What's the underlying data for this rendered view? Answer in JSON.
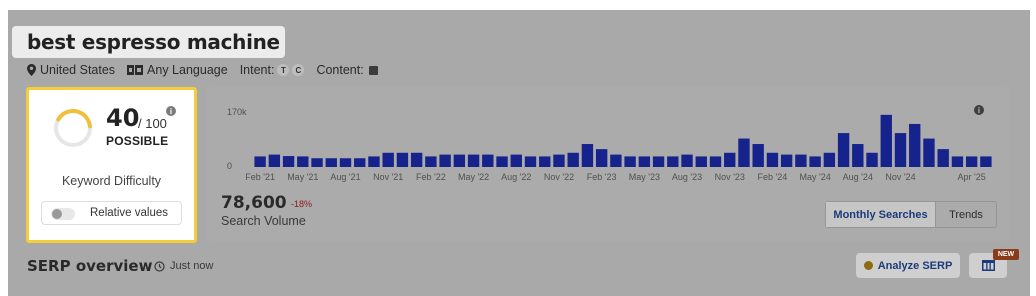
{
  "keyword": {
    "title": "best espresso machine"
  },
  "meta": {
    "location": "United States",
    "language": "Any Language",
    "intent_label": "Intent:",
    "intent_badges": [
      "T",
      "C"
    ],
    "content_label": "Content:"
  },
  "difficulty": {
    "value": "40",
    "max": "/ 100",
    "level": "POSSIBLE",
    "label": "Keyword Difficulty",
    "relative_label": "Relative values",
    "fraction": 0.4,
    "info": "i"
  },
  "volume": {
    "value": "78,600",
    "change": "-18%",
    "label": "Search Volume",
    "info": "i",
    "tabs": [
      {
        "label": "Monthly Searches",
        "active": true
      },
      {
        "label": "Trends",
        "active": false
      }
    ]
  },
  "serp": {
    "title": "SERP overview",
    "time": "Just now",
    "analyze_button": "Analyze SERP",
    "new_badge": "NEW"
  },
  "colors": {
    "bar": "#16238c",
    "difficulty_ring": "#f0c03a",
    "card_border": "#f3cd3a"
  },
  "chart_data": {
    "type": "bar",
    "ylim": [
      0,
      170000
    ],
    "y_ticks": [
      "0",
      "170k"
    ],
    "x_tick_labels": [
      "Feb '21",
      "May '21",
      "Aug '21",
      "Nov '21",
      "Feb '22",
      "May '22",
      "Aug '22",
      "Nov '22",
      "Feb '23",
      "May '23",
      "Aug '23",
      "Nov '23",
      "Feb '24",
      "May '24",
      "Aug '24",
      "Nov '24",
      "Apr '25"
    ],
    "categories": [
      "2021-02",
      "2021-03",
      "2021-04",
      "2021-05",
      "2021-06",
      "2021-07",
      "2021-08",
      "2021-09",
      "2021-10",
      "2021-11",
      "2021-12",
      "2022-01",
      "2022-02",
      "2022-03",
      "2022-04",
      "2022-05",
      "2022-06",
      "2022-07",
      "2022-08",
      "2022-09",
      "2022-10",
      "2022-11",
      "2022-12",
      "2023-01",
      "2023-02",
      "2023-03",
      "2023-04",
      "2023-05",
      "2023-06",
      "2023-07",
      "2023-08",
      "2023-09",
      "2023-10",
      "2023-11",
      "2023-12",
      "2024-01",
      "2024-02",
      "2024-03",
      "2024-04",
      "2024-05",
      "2024-06",
      "2024-07",
      "2024-08",
      "2024-09",
      "2024-10",
      "2024-11",
      "2024-12",
      "2025-01",
      "2025-02",
      "2025-03",
      "2025-04"
    ],
    "values": [
      29000,
      34000,
      30000,
      29000,
      24000,
      24000,
      24000,
      24000,
      29000,
      39000,
      39000,
      39000,
      29000,
      34000,
      34000,
      34000,
      34000,
      29000,
      34000,
      29000,
      29000,
      34000,
      39000,
      63000,
      49000,
      34000,
      29000,
      29000,
      29000,
      29000,
      34000,
      29000,
      29000,
      39000,
      78000,
      63000,
      39000,
      34000,
      34000,
      29000,
      39000,
      93000,
      63000,
      39000,
      143000,
      93000,
      118000,
      78000,
      49000,
      29000,
      29000,
      29000
    ]
  }
}
